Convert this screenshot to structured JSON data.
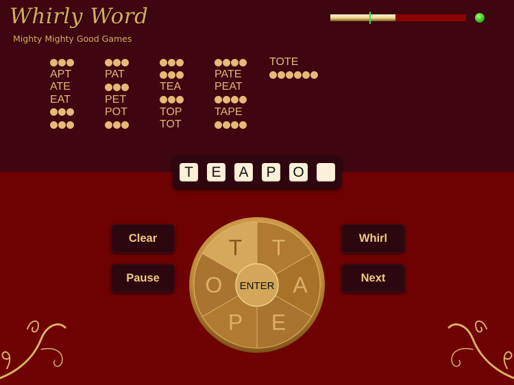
{
  "header": {
    "title": "Whirly Word",
    "subtitle": "Mighty Mighty Good Games"
  },
  "timer": {
    "remaining_fraction": 0.48,
    "marker_fraction": 0.29,
    "status_color": "#3cc41c"
  },
  "word_columns": [
    [
      {
        "found": false,
        "length": 3
      },
      {
        "found": true,
        "word": "APT"
      },
      {
        "found": true,
        "word": "ATE"
      },
      {
        "found": true,
        "word": "EAT"
      },
      {
        "found": false,
        "length": 3
      },
      {
        "found": false,
        "length": 3
      }
    ],
    [
      {
        "found": false,
        "length": 3
      },
      {
        "found": true,
        "word": "PAT"
      },
      {
        "found": false,
        "length": 3
      },
      {
        "found": true,
        "word": "PET"
      },
      {
        "found": true,
        "word": "POT"
      },
      {
        "found": false,
        "length": 3
      }
    ],
    [
      {
        "found": false,
        "length": 3
      },
      {
        "found": false,
        "length": 3
      },
      {
        "found": true,
        "word": "TEA"
      },
      {
        "found": false,
        "length": 3
      },
      {
        "found": true,
        "word": "TOP"
      },
      {
        "found": true,
        "word": "TOT"
      }
    ],
    [
      {
        "found": false,
        "length": 4
      },
      {
        "found": true,
        "word": "PATE"
      },
      {
        "found": true,
        "word": "PEAT"
      },
      {
        "found": false,
        "length": 4
      },
      {
        "found": true,
        "word": "TAPE"
      },
      {
        "found": false,
        "length": 4
      }
    ],
    [
      {
        "found": true,
        "word": "TOTE"
      },
      {
        "found": false,
        "length": 6
      }
    ]
  ],
  "current_entry": {
    "tiles": [
      "T",
      "E",
      "A",
      "P",
      "O",
      ""
    ]
  },
  "buttons": {
    "clear": "Clear",
    "pause": "Pause",
    "whirl": "Whirl",
    "next": "Next"
  },
  "wheel": {
    "center_label": "ENTER",
    "letters": [
      "T",
      "A",
      "E",
      "P",
      "O",
      "T"
    ],
    "selected_index": 5
  },
  "colors": {
    "top_bg": "#3e0610",
    "bottom_bg": "#6e0203",
    "text_gold": "#e5b977",
    "wheel_gold": "#b07a30"
  }
}
